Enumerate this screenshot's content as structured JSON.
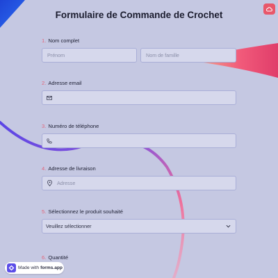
{
  "form": {
    "title": "Formulaire de Commande de Crochet",
    "questions": [
      {
        "number": "1.",
        "label": "Nom complet",
        "first_placeholder": "Prénom",
        "last_placeholder": "Nom de famille"
      },
      {
        "number": "2.",
        "label": "Adresse email",
        "placeholder": ""
      },
      {
        "number": "3.",
        "label": "Numéro de téléphone",
        "placeholder": ""
      },
      {
        "number": "4.",
        "label": "Adresse de livraison",
        "placeholder": "Adresse"
      },
      {
        "number": "5.",
        "label": "Sélectionnez le produit souhaité",
        "selected": "Veuillez sélectionner"
      },
      {
        "number": "6.",
        "label": "Quantité"
      }
    ]
  },
  "footer": {
    "made_with": "Made with",
    "brand": "forms.app"
  },
  "icons": {
    "email": "mail-icon",
    "phone": "phone-icon",
    "address": "location-pin-icon",
    "select": "chevron-down-icon",
    "corner": "cloud-upload-icon",
    "badge": "forms-app-logo-icon"
  },
  "colors": {
    "background": "#c5c8e2",
    "accent": "#e2667a",
    "field_border": "#a9aed7",
    "field_bg": "#d6d8ec"
  }
}
